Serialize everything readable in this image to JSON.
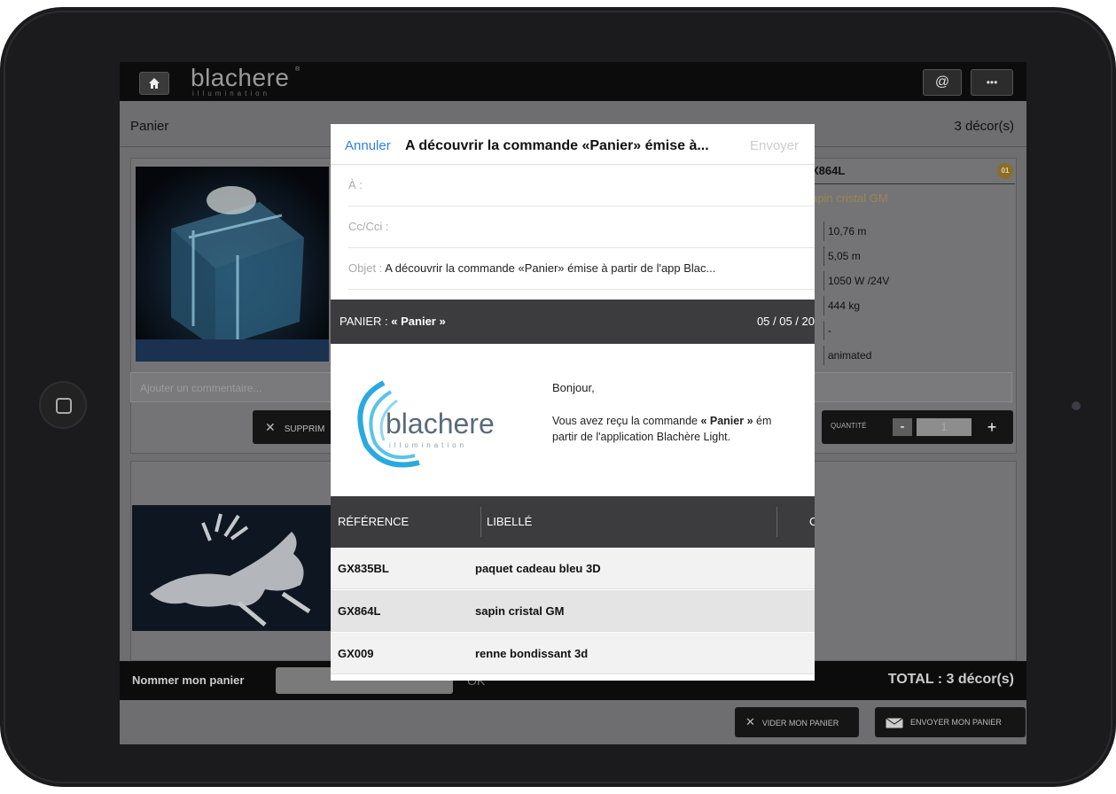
{
  "app": {
    "logo_text": "blachere",
    "logo_sub": "illumination",
    "logo_reg": "®",
    "at_button": "@",
    "more_button": "•••"
  },
  "header": {
    "title": "Panier",
    "count": "3 décor(s)"
  },
  "product": {
    "ref": "X864L",
    "badge": "01",
    "name": "apin cristal GM",
    "specs": [
      "10,76 m",
      "5,05 m",
      "1050 W /24V",
      "444 kg",
      "-",
      "animated"
    ],
    "comment_placeholder": "Ajouter un commentaire...",
    "delete_label": "SUPPRIM",
    "quantity_label": "QUANTITÉ",
    "quantity_value": "1",
    "minus": "-",
    "plus": "+"
  },
  "namebar": {
    "label": "Nommer mon panier",
    "ok": "OK",
    "total": "TOTAL : 3 décor(s)"
  },
  "actions": {
    "clear": "VIDER MON PANIER",
    "send": "ENVOYER MON PANIER"
  },
  "modal": {
    "cancel": "Annuler",
    "title": "A découvrir la commande «Panier» émise à...",
    "send": "Envoyer",
    "to_label": "À :",
    "cc_label": "Cc/Cci :",
    "subject_label": "Objet :",
    "subject_value": "A découvrir la commande «Panier» émise à partir de l'app Blac...",
    "band_left_prefix": "PANIER : ",
    "band_left_bold": "« Panier »",
    "band_right": "05 / 05 / 20",
    "logo_text": "blachere",
    "logo_sub": "illumination",
    "greeting": "Bonjour,",
    "body_line1_a": "Vous avez reçu la commande ",
    "body_line1_b": "« Panier »",
    "body_line1_c": " ém",
    "body_line2": "partir de l'application Blachère Light.",
    "table": {
      "headers": [
        "RÉFÉRENCE",
        "LIBELLÉ",
        "C"
      ],
      "rows": [
        {
          "ref": "GX835BL",
          "label": "paquet cadeau bleu 3D"
        },
        {
          "ref": "GX864L",
          "label": "sapin cristal GM"
        },
        {
          "ref": "GX009",
          "label": "renne bondissant 3d"
        }
      ]
    }
  }
}
